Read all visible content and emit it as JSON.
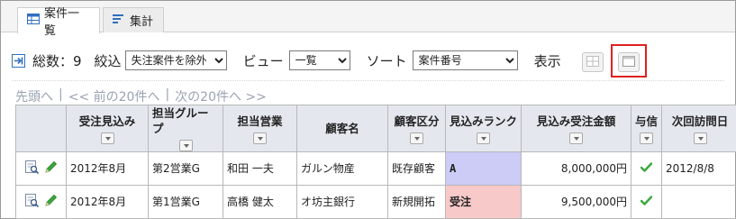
{
  "tabs": [
    {
      "label": "案件一覧",
      "icon": "table-icon",
      "active": true
    },
    {
      "label": "集計",
      "icon": "bar-chart-icon",
      "active": false
    }
  ],
  "toolbar": {
    "total_label": "総数：9",
    "filter_label": "絞込",
    "filter_value": "失注案件を除外",
    "view_label": "ビュー",
    "view_value": "一覧",
    "sort_label": "ソート",
    "sort_value": "案件番号",
    "display_label": "表示"
  },
  "pager": {
    "first": "先頭へ",
    "sep1": "|",
    "prev": "<< 前の20件へ",
    "sep2": "|",
    "next": "次の20件へ >>"
  },
  "table": {
    "headers": [
      "",
      "受注見込み",
      "担当グループ",
      "担当営業",
      "顧客名",
      "顧客区分",
      "見込みランク",
      "見込み受注金額",
      "与信",
      "次回訪問日"
    ],
    "rows": [
      {
        "month": "2012年8月",
        "group": "第2営業G",
        "sales": "和田 一夫",
        "customer": "ガルン物産",
        "category": "既存顧客",
        "rank": "A",
        "amount": "8,000,000円",
        "credit": "check",
        "next_visit": "2012/8/8"
      },
      {
        "month": "2012年8月",
        "group": "第1営業G",
        "sales": "高橋 健太",
        "customer": "オ坊主銀行",
        "category": "新規開拓",
        "rank": "受注",
        "amount": "9,500,000円",
        "credit": "check",
        "next_visit": ""
      }
    ]
  },
  "colors": {
    "rank_a_bg": "#ccccf6",
    "rank_won_bg": "#f8c9c9",
    "highlight": "#e02020",
    "header_bg": "#e4e8ee"
  }
}
